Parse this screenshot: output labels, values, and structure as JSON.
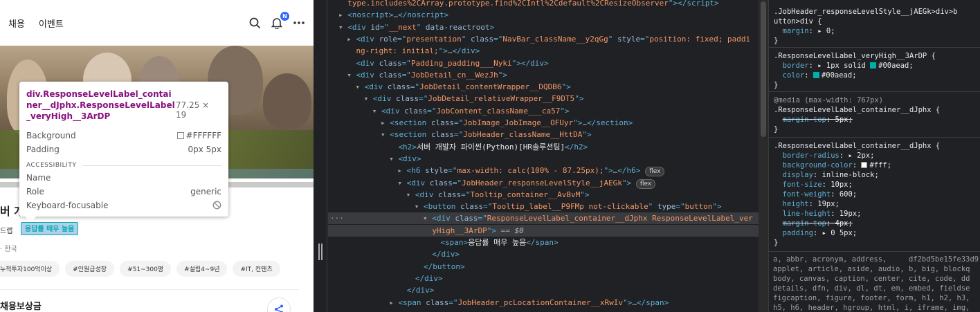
{
  "page": {
    "nav": [
      "채용",
      "이벤트"
    ],
    "notification_badge": "N",
    "title_fragment": "버 개",
    "company_fragment": "드랩",
    "response_label": "응답률 매우 높음",
    "location_fragment": "· 한국",
    "tags": [
      "누적투자100억이상",
      "#인원급성장",
      "#51~300명",
      "#설립4~9년",
      "#IT, 컨텐츠"
    ],
    "reward_fragment": "채용보상금"
  },
  "tooltip": {
    "selector": "div.ResponseLevelLabel_container__dJphx.ResponseLevelLabel_veryHigh__3ArDP",
    "dimensions": "77.25 × 19",
    "background_label": "Background",
    "background_value": "#FFFFFF",
    "padding_label": "Padding",
    "padding_value": "0px 5px",
    "accessibility": "ACCESSIBILITY",
    "name_label": "Name",
    "role_label": "Role",
    "role_value": "generic",
    "focus_label": "Keyboard-focusable"
  },
  "elements": {
    "lines": [
      {
        "indent": 0,
        "tri": "",
        "html": "<span class='av'>type.includes%2CArray.prototype.find%2CIntl%2Cdefault%2CResizeObserver</span><span class='tg'>\"&gt;&lt;/script&gt;</span>"
      },
      {
        "indent": 0,
        "tri": "▸",
        "html": "<span class='tg'>&lt;noscript&gt;</span>…<span class='tg'>&lt;/noscript&gt;</span>"
      },
      {
        "indent": 0,
        "tri": "▾",
        "html": "<span class='tg'>&lt;div </span><span class='at'>id</span><span class='tg'>=\"</span><span class='av'>__next</span><span class='tg'>\" </span><span class='at'>data-reactroot</span><span class='tg'>&gt;</span>"
      },
      {
        "indent": 1,
        "tri": "▸",
        "html": "<span class='tg'>&lt;div </span><span class='at'>role</span><span class='tg'>=\"</span><span class='av'>presentation</span><span class='tg'>\" </span><span class='at'>class</span><span class='tg'>=\"</span><span class='av'>NavBar_className__y2qGg</span><span class='tg'>\" </span><span class='at'>style</span><span class='tg'>=\"</span><span class='av'>position: fixed; paddi</span>"
      },
      {
        "indent": 1,
        "tri": "",
        "html": "<span class='av'>ng-right: initial;</span><span class='tg'>\"&gt;</span>…<span class='tg'>&lt;/div&gt;</span>"
      },
      {
        "indent": 1,
        "tri": "",
        "html": "<span class='tg'>&lt;div </span><span class='at'>class</span><span class='tg'>=\"</span><span class='av'>Padding_padding___Nyki</span><span class='tg'>\"&gt;&lt;/div&gt;</span>"
      },
      {
        "indent": 1,
        "tri": "▾",
        "html": "<span class='tg'>&lt;div </span><span class='at'>class</span><span class='tg'>=\"</span><span class='av'>JobDetail_cn__WezJh</span><span class='tg'>\"&gt;</span>"
      },
      {
        "indent": 2,
        "tri": "▾",
        "html": "<span class='tg'>&lt;div </span><span class='at'>class</span><span class='tg'>=\"</span><span class='av'>JobDetail_contentWrapper__DQDB6</span><span class='tg'>\"&gt;</span>"
      },
      {
        "indent": 3,
        "tri": "▾",
        "html": "<span class='tg'>&lt;div </span><span class='at'>class</span><span class='tg'>=\"</span><span class='av'>JobDetail_relativeWrapper__F9DT5</span><span class='tg'>\"&gt;</span>"
      },
      {
        "indent": 4,
        "tri": "▾",
        "html": "<span class='tg'>&lt;div </span><span class='at'>class</span><span class='tg'>=\"</span><span class='av'>JobContent_className___ca57</span><span class='tg'>\"&gt;</span>"
      },
      {
        "indent": 5,
        "tri": "▸",
        "html": "<span class='tg'>&lt;section </span><span class='at'>class</span><span class='tg'>=\"</span><span class='av'>JobImage_JobImage__OFUyr</span><span class='tg'>\"&gt;</span>…<span class='tg'>&lt;/section&gt;</span>"
      },
      {
        "indent": 5,
        "tri": "▾",
        "html": "<span class='tg'>&lt;section </span><span class='at'>class</span><span class='tg'>=\"</span><span class='av'>JobHeader_className__HttDA</span><span class='tg'>\"&gt;</span>"
      },
      {
        "indent": 6,
        "tri": "",
        "html": "<span class='tg'>&lt;h2&gt;</span><span class='tx'>서버 개발자 파이썬(Python)[HR솔루션팀]</span><span class='tg'>&lt;/h2&gt;</span>"
      },
      {
        "indent": 6,
        "tri": "▾",
        "html": "<span class='tg'>&lt;div&gt;</span>"
      },
      {
        "indent": 7,
        "tri": "▸",
        "html": "<span class='tg'>&lt;h6 </span><span class='at'>style</span><span class='tg'>=\"</span><span class='av'>max-width: calc(100% - 87.25px);</span><span class='tg'>\"&gt;</span>…<span class='tg'>&lt;/h6&gt;</span> <span class='pill'>flex</span>"
      },
      {
        "indent": 7,
        "tri": "▾",
        "html": "<span class='tg'>&lt;div </span><span class='at'>class</span><span class='tg'>=\"</span><span class='av'>JobHeader_responseLevelStyle__jAEGk</span><span class='tg'>\"&gt;</span> <span class='pill'>flex</span>"
      },
      {
        "indent": 8,
        "tri": "▾",
        "html": "<span class='tg'>&lt;div </span><span class='at'>class</span><span class='tg'>=\"</span><span class='av'>Tooltip_container__AvBvM</span><span class='tg'>\"&gt;</span>"
      },
      {
        "indent": 9,
        "tri": "▾",
        "html": "<span class='tg'>&lt;button </span><span class='at'>class</span><span class='tg'>=\"</span><span class='av'>Tooltip_label__P9FMp not-clickable</span><span class='tg'>\" </span><span class='at'>type</span><span class='tg'>=\"</span><span class='av'>button</span><span class='tg'>\"&gt;</span>"
      },
      {
        "indent": 10,
        "tri": "▾",
        "sel": true,
        "html": "<span class='tg'>&lt;div </span><span class='at'>class</span><span class='tg'>=\"</span><span class='av'>ResponseLevelLabel_container__dJphx ResponseLevelLabel_ver</span>"
      },
      {
        "indent": 10,
        "tri": "",
        "sel": true,
        "html": "<span class='av'>yHigh__3ArDP</span><span class='tg'>\"&gt;</span> == <span class='dollar'>$0</span>"
      },
      {
        "indent": 11,
        "tri": "",
        "html": "<span class='tg'>&lt;span&gt;</span><span class='tx'>응답률 매우 높음</span><span class='tg'>&lt;/span&gt;</span>"
      },
      {
        "indent": 10,
        "tri": "",
        "html": "<span class='tg'>&lt;/div&gt;</span>"
      },
      {
        "indent": 9,
        "tri": "",
        "html": "<span class='tg'>&lt;/button&gt;</span>"
      },
      {
        "indent": 8,
        "tri": "",
        "html": "<span class='tg'>&lt;/div&gt;</span>"
      },
      {
        "indent": 7,
        "tri": "",
        "html": "<span class='tg'>&lt;/div&gt;</span>"
      },
      {
        "indent": 6,
        "tri": "▸",
        "html": "<span class='tg'>&lt;span </span><span class='at'>class</span><span class='tg'>=\"</span><span class='av'>JobHeader_pcLocationContainer__xRwIv</span><span class='tg'>\"&gt;</span>…<span class='tg'>&lt;/span&gt;</span>"
      }
    ],
    "dots": "···"
  },
  "styles": {
    "rule1_selector": ".JobHeader_responseLevelStyle__jAEGk>div>b",
    "rule1_selector2": "utton>div {",
    "rule1_prop": "margin",
    "rule1_val": "0",
    "rule2_selector": ".ResponseLevelLabel_veryHigh__3ArDP {",
    "rule2_border": "1px solid",
    "rule2_border_color": "#00aead",
    "rule2_color": "#00aead",
    "media": "@media (max-width: 767px)",
    "rule3_selector": ".ResponseLevelLabel_container__dJphx {",
    "rule3_prop": "margin-top",
    "rule3_val": "5px",
    "rule4_selector": ".ResponseLevelLabel_container__dJphx {",
    "rule4_props": [
      {
        "p": "border-radius",
        "v": "2px",
        "tri": true
      },
      {
        "p": "background-color",
        "v": "#fff",
        "sw": "#ffffff"
      },
      {
        "p": "display",
        "v": "inline-block"
      },
      {
        "p": "font-size",
        "v": "10px"
      },
      {
        "p": "font-weight",
        "v": "600"
      },
      {
        "p": "height",
        "v": "19px"
      },
      {
        "p": "line-height",
        "v": "19px"
      },
      {
        "p": "margin-top",
        "v": "4px",
        "strike": true
      },
      {
        "p": "padding",
        "v": "0 5px",
        "tri": true
      }
    ],
    "close": "}",
    "tag_list": "a, abbr, acronym, address,     df2bd5be15fe33d9\napplet, article, aside, audio, b, big, blockq\nbody, canvas, caption, center, cite, code, dd\ndetails, dfn, div, dl, dt, em, embed, fieldse\nfigcaption, figure, footer, form, h1, h2, h3,\nh5, h6, header, hgroup, html, i, iframe, img,"
  }
}
